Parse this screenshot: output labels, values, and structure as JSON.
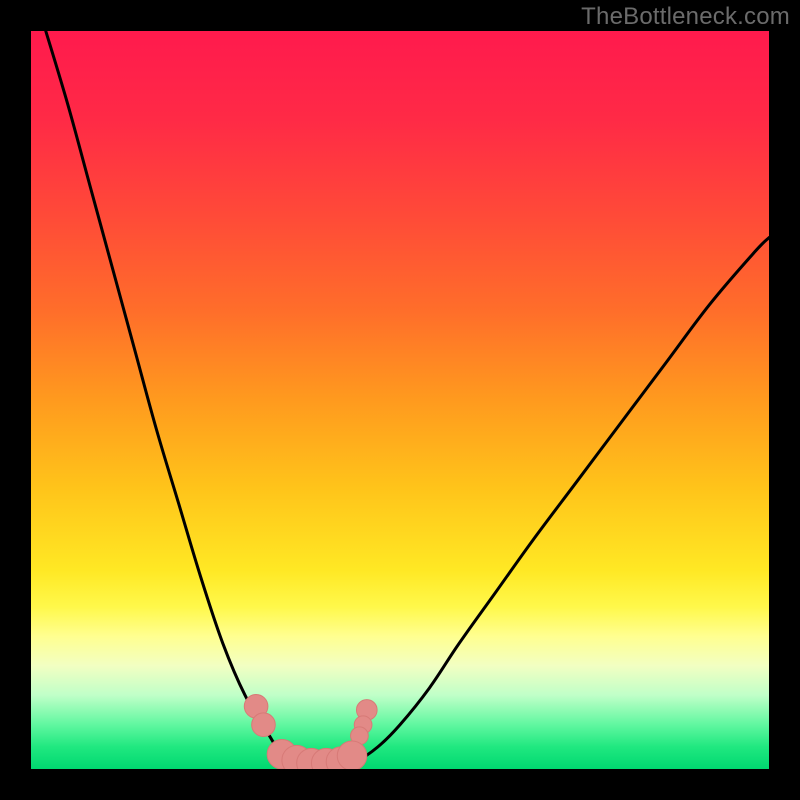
{
  "watermark": "TheBottleneck.com",
  "colors": {
    "frame": "#000000",
    "curve_stroke": "#000000",
    "curve_stroke_width": 3,
    "marker_fill": "#e28a87",
    "marker_stroke": "#d77a77",
    "gradient_stops": [
      {
        "offset": 0.0,
        "color": "#ff1a4d"
      },
      {
        "offset": 0.12,
        "color": "#ff2a46"
      },
      {
        "offset": 0.25,
        "color": "#ff4a38"
      },
      {
        "offset": 0.38,
        "color": "#ff6e2a"
      },
      {
        "offset": 0.5,
        "color": "#ff9a1e"
      },
      {
        "offset": 0.62,
        "color": "#ffc41a"
      },
      {
        "offset": 0.73,
        "color": "#ffe824"
      },
      {
        "offset": 0.78,
        "color": "#fff84a"
      },
      {
        "offset": 0.82,
        "color": "#ffff90"
      },
      {
        "offset": 0.86,
        "color": "#f2ffc2"
      },
      {
        "offset": 0.9,
        "color": "#c0ffc8"
      },
      {
        "offset": 0.94,
        "color": "#60f7a0"
      },
      {
        "offset": 0.97,
        "color": "#20e880"
      },
      {
        "offset": 1.0,
        "color": "#00d870"
      }
    ]
  },
  "chart_data": {
    "type": "line",
    "title": "",
    "xlabel": "",
    "ylabel": "",
    "xlim": [
      0,
      100
    ],
    "ylim": [
      0,
      100
    ],
    "series": [
      {
        "name": "left-arm",
        "x": [
          2,
          5,
          8,
          11,
          14,
          17,
          20,
          23,
          26,
          29,
          32,
          34,
          36
        ],
        "values": [
          100,
          90,
          79,
          68,
          57,
          46,
          36,
          26,
          17,
          10,
          5,
          2,
          1
        ]
      },
      {
        "name": "trough",
        "x": [
          36,
          38,
          40,
          42,
          44
        ],
        "values": [
          1,
          0.6,
          0.5,
          0.6,
          1
        ]
      },
      {
        "name": "right-arm",
        "x": [
          44,
          47,
          50,
          54,
          58,
          63,
          68,
          74,
          80,
          86,
          92,
          98,
          100
        ],
        "values": [
          1,
          3,
          6,
          11,
          17,
          24,
          31,
          39,
          47,
          55,
          63,
          70,
          72
        ]
      }
    ],
    "markers": [
      {
        "label": "left-upper-dot",
        "x": 30.5,
        "y": 8.5,
        "r": 1.6
      },
      {
        "label": "left-lower-dot",
        "x": 31.5,
        "y": 6.0,
        "r": 1.6
      },
      {
        "label": "right-upper-dot",
        "x": 45.5,
        "y": 8.0,
        "r": 1.4
      },
      {
        "label": "right-mid-dot",
        "x": 45.0,
        "y": 6.0,
        "r": 1.2
      },
      {
        "label": "right-lower-dot",
        "x": 44.5,
        "y": 4.5,
        "r": 1.2
      },
      {
        "label": "trough-cap-1",
        "x": 34.0,
        "y": 2.0,
        "r": 2.0
      },
      {
        "label": "trough-cap-2",
        "x": 36.0,
        "y": 1.2,
        "r": 2.0
      },
      {
        "label": "trough-cap-3",
        "x": 38.0,
        "y": 0.8,
        "r": 2.0
      },
      {
        "label": "trough-cap-4",
        "x": 40.0,
        "y": 0.8,
        "r": 2.0
      },
      {
        "label": "trough-cap-5",
        "x": 42.0,
        "y": 1.0,
        "r": 2.0
      },
      {
        "label": "trough-cap-6",
        "x": 43.5,
        "y": 1.8,
        "r": 2.0
      }
    ]
  }
}
